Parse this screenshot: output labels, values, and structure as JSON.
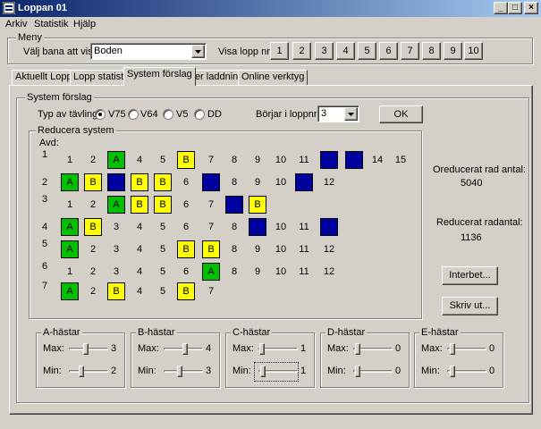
{
  "window": {
    "title": "Loppan 01",
    "controls": [
      "_",
      "□",
      "×"
    ]
  },
  "menubar": [
    "Arkiv",
    "Statistik",
    "Hjälp"
  ],
  "meny": {
    "legend": "Meny",
    "bana_label": "Välj bana att visa:",
    "bana_value": "Boden",
    "visa_label": "Visa lopp nr:",
    "lopp_buttons": [
      "1",
      "2",
      "3",
      "4",
      "5",
      "6",
      "7",
      "8",
      "9",
      "10"
    ]
  },
  "tabs": [
    "Aktuellt Lopp",
    "Lopp statistik",
    "System förslag",
    "Ner laddning",
    "Online verktyg"
  ],
  "active_tab": "System förslag",
  "system": {
    "legend": "System förslag",
    "typ_label": "Typ av tävling:",
    "options": [
      "V75",
      "V64",
      "V5",
      "DD"
    ],
    "selected": "V75",
    "borjar_label": "Börjar i loppnr.:",
    "borjar_value": "3",
    "ok_label": "OK"
  },
  "reducera": {
    "legend": "Reducera system",
    "avd_label": "Avd:",
    "rows": [
      {
        "avd": "1",
        "cells": [
          {
            "t": "1",
            "c": ""
          },
          {
            "t": "2",
            "c": ""
          },
          {
            "t": "A",
            "c": "g"
          },
          {
            "t": "4",
            "c": ""
          },
          {
            "t": "5",
            "c": ""
          },
          {
            "t": "B",
            "c": "y"
          },
          {
            "t": "7",
            "c": ""
          },
          {
            "t": "8",
            "c": ""
          },
          {
            "t": "9",
            "c": ""
          },
          {
            "t": "10",
            "c": ""
          },
          {
            "t": "11",
            "c": ""
          },
          {
            "t": "12",
            "c": "b"
          },
          {
            "t": "13",
            "c": "b"
          },
          {
            "t": "14",
            "c": ""
          },
          {
            "t": "15",
            "c": ""
          }
        ]
      },
      {
        "avd": "2",
        "cells": [
          {
            "t": "A",
            "c": "g"
          },
          {
            "t": "B",
            "c": "y"
          },
          {
            "t": "3",
            "c": "b"
          },
          {
            "t": "B",
            "c": "y"
          },
          {
            "t": "B",
            "c": "y"
          },
          {
            "t": "6",
            "c": ""
          },
          {
            "t": "7",
            "c": "b"
          },
          {
            "t": "8",
            "c": ""
          },
          {
            "t": "9",
            "c": ""
          },
          {
            "t": "10",
            "c": ""
          },
          {
            "t": "11",
            "c": "b"
          },
          {
            "t": "12",
            "c": ""
          }
        ]
      },
      {
        "avd": "3",
        "cells": [
          {
            "t": "1",
            "c": ""
          },
          {
            "t": "2",
            "c": ""
          },
          {
            "t": "A",
            "c": "g"
          },
          {
            "t": "B",
            "c": "y"
          },
          {
            "t": "B",
            "c": "y"
          },
          {
            "t": "6",
            "c": ""
          },
          {
            "t": "7",
            "c": ""
          },
          {
            "t": "8",
            "c": "b"
          },
          {
            "t": "B",
            "c": "y"
          }
        ]
      },
      {
        "avd": "4",
        "cells": [
          {
            "t": "A",
            "c": "g"
          },
          {
            "t": "B",
            "c": "y"
          },
          {
            "t": "3",
            "c": ""
          },
          {
            "t": "4",
            "c": ""
          },
          {
            "t": "5",
            "c": ""
          },
          {
            "t": "6",
            "c": ""
          },
          {
            "t": "7",
            "c": ""
          },
          {
            "t": "8",
            "c": ""
          },
          {
            "t": "9",
            "c": "b"
          },
          {
            "t": "10",
            "c": ""
          },
          {
            "t": "11",
            "c": ""
          },
          {
            "t": "12",
            "c": "b"
          }
        ]
      },
      {
        "avd": "5",
        "cells": [
          {
            "t": "A",
            "c": "g"
          },
          {
            "t": "2",
            "c": ""
          },
          {
            "t": "3",
            "c": ""
          },
          {
            "t": "4",
            "c": ""
          },
          {
            "t": "5",
            "c": ""
          },
          {
            "t": "B",
            "c": "y"
          },
          {
            "t": "B",
            "c": "y"
          },
          {
            "t": "8",
            "c": ""
          },
          {
            "t": "9",
            "c": ""
          },
          {
            "t": "10",
            "c": ""
          },
          {
            "t": "11",
            "c": ""
          },
          {
            "t": "12",
            "c": ""
          }
        ]
      },
      {
        "avd": "6",
        "cells": [
          {
            "t": "1",
            "c": ""
          },
          {
            "t": "2",
            "c": ""
          },
          {
            "t": "3",
            "c": ""
          },
          {
            "t": "4",
            "c": ""
          },
          {
            "t": "5",
            "c": ""
          },
          {
            "t": "6",
            "c": ""
          },
          {
            "t": "A",
            "c": "g"
          },
          {
            "t": "8",
            "c": ""
          },
          {
            "t": "9",
            "c": ""
          },
          {
            "t": "10",
            "c": ""
          },
          {
            "t": "11",
            "c": ""
          },
          {
            "t": "12",
            "c": ""
          }
        ]
      },
      {
        "avd": "7",
        "cells": [
          {
            "t": "A",
            "c": "g"
          },
          {
            "t": "2",
            "c": ""
          },
          {
            "t": "B",
            "c": "y"
          },
          {
            "t": "4",
            "c": ""
          },
          {
            "t": "5",
            "c": ""
          },
          {
            "t": "B",
            "c": "y"
          },
          {
            "t": "7",
            "c": ""
          }
        ]
      }
    ],
    "oreducerat_label": "Oreducerat rad antal:",
    "oreducerat_value": "5040",
    "reducerat_label": "Reducerat radantal:",
    "reducerat_value": "1136",
    "interbet_label": "Interbet...",
    "skriv_label": "Skriv ut..."
  },
  "hastar": [
    {
      "legend": "A-hästar",
      "max_label": "Max:",
      "max": "3",
      "min_label": "Min:",
      "min": "2"
    },
    {
      "legend": "B-hästar",
      "max_label": "Max:",
      "max": "4",
      "min_label": "Min:",
      "min": "3"
    },
    {
      "legend": "C-hästar",
      "max_label": "Max:",
      "max": "1",
      "min_label": "Min:",
      "min": "1"
    },
    {
      "legend": "D-hästar",
      "max_label": "Max:",
      "max": "0",
      "min_label": "Min:",
      "min": "0"
    },
    {
      "legend": "E-hästar",
      "max_label": "Max:",
      "max": "0",
      "min_label": "Min:",
      "min": "0"
    }
  ],
  "colors": {
    "a_green": "#00c000",
    "b_yellow": "#ffff00",
    "blocked_blue": "#0000a0"
  }
}
